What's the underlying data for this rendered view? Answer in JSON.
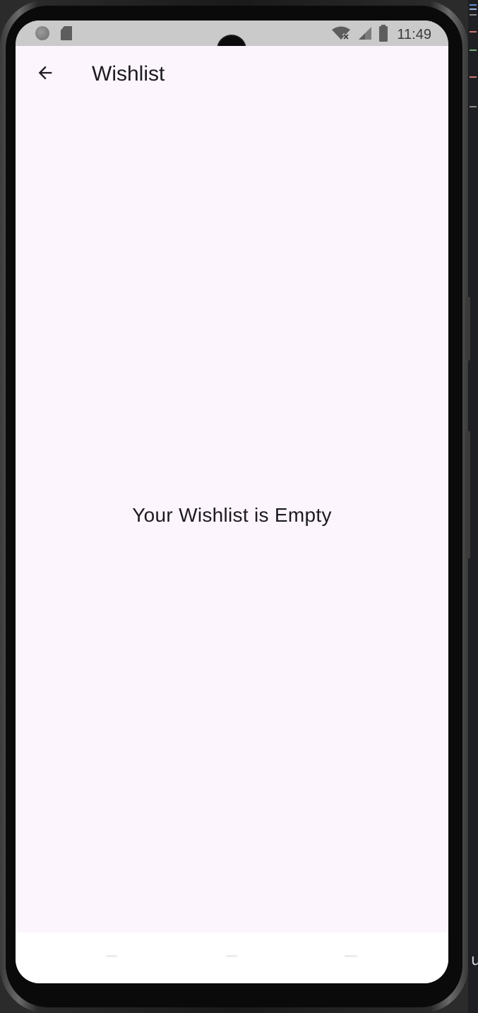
{
  "status_bar": {
    "time": "11:49",
    "left_icons": [
      "circle-notification-icon",
      "sd-card-icon"
    ],
    "right_icons": [
      "wifi-off-icon",
      "signal-icon",
      "battery-icon"
    ]
  },
  "app_bar": {
    "back_icon": "arrow-left-icon",
    "title": "Wishlist"
  },
  "content": {
    "empty_message": "Your Wishlist is Empty"
  },
  "colors": {
    "background": "#fcf5fd",
    "status_bar": "#cacaca",
    "text": "#1d1b20",
    "nav_bar": "#ffffff"
  }
}
